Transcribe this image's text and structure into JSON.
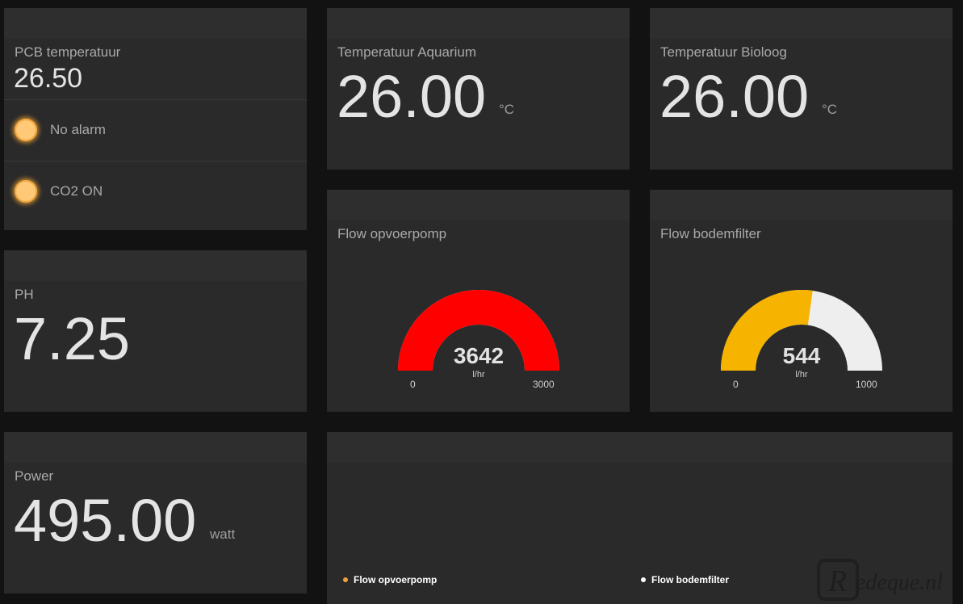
{
  "pcb": {
    "title": "PCB temperatuur",
    "value": "26.50"
  },
  "alarms": [
    {
      "label": "No alarm"
    },
    {
      "label": "CO2 ON"
    }
  ],
  "ph": {
    "title": "PH",
    "value": "7.25"
  },
  "power": {
    "title": "Power",
    "value": "495.00",
    "unit": "watt"
  },
  "temp_aquarium": {
    "title": "Temperatuur Aquarium",
    "value": "26.00",
    "unit": "°C"
  },
  "temp_bioloog": {
    "title": "Temperatuur Bioloog",
    "value": "26.00",
    "unit": "°C"
  },
  "gauges": [
    {
      "title": "Flow opvoerpomp",
      "value": 3642,
      "value_text": "3642",
      "unit": "l/hr",
      "min": 0,
      "max": 3000,
      "min_text": "0",
      "max_text": "3000",
      "color": "#ff0000",
      "track": "#eeeeee"
    },
    {
      "title": "Flow bodemfilter",
      "value": 544,
      "value_text": "544",
      "unit": "l/hr",
      "min": 0,
      "max": 1000,
      "min_text": "0",
      "max_text": "1000",
      "color": "#f6b400",
      "track": "#eeeeee"
    }
  ],
  "legend": [
    {
      "label": "Flow opvoerpomp",
      "color": "#f2a13a"
    },
    {
      "label": "Flow bodemfilter",
      "color": "#ffffff"
    }
  ],
  "watermark": "Redeque.nl"
}
